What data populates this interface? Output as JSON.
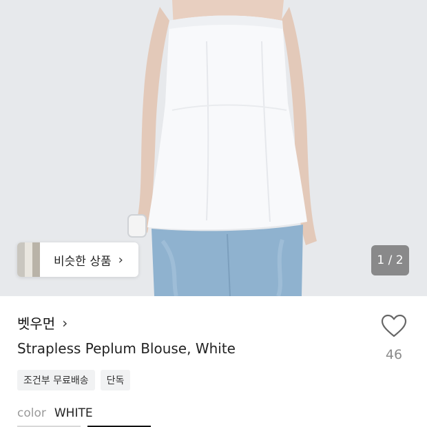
{
  "gallery": {
    "similar_label": "비슷한 상품",
    "similar_chevron": "›",
    "counter": "1 / 2",
    "thumb_colors": [
      "#c9c6bf",
      "#e9e6df",
      "#b9b3a8"
    ]
  },
  "product": {
    "brand": "벳우먼",
    "brand_chevron": "›",
    "title": "Strapless Peplum Blouse, White",
    "tags": [
      "조건부 무료배송",
      "단독"
    ],
    "color_label": "color",
    "color_value": "WHITE",
    "like_count": "46",
    "like_icon": "heart-outline-icon"
  }
}
